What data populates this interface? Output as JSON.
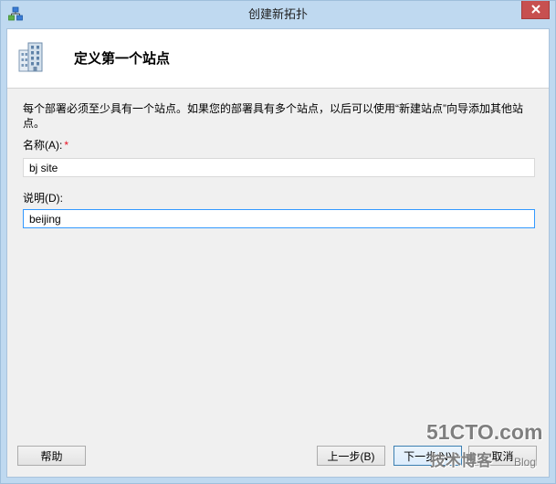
{
  "window": {
    "title": "创建新拓扑"
  },
  "header": {
    "title": "定义第一个站点"
  },
  "body": {
    "description": "每个部署必须至少具有一个站点。如果您的部署具有多个站点，以后可以使用“新建站点”向导添加其他站点。",
    "name_field": {
      "label": "名称(A):",
      "required_marker": "*",
      "value": "bj site"
    },
    "description_field": {
      "label": "说明(D):",
      "value": "beijing"
    }
  },
  "footer": {
    "help": "帮助",
    "back": "上一步(B)",
    "next": "下一步(N)",
    "cancel": "取消"
  },
  "watermark": {
    "brand": "51CTO.com",
    "subtitle": "技术博客",
    "blog": "Blog"
  },
  "icons": {
    "app": "topology-icon",
    "header": "building-icon",
    "close": "close-icon"
  },
  "colors": {
    "frame": "#bfd9f0",
    "close_button": "#c75050",
    "required_marker": "#e81123",
    "focus_border": "#3399ff",
    "default_button_border": "#3c7fb1"
  }
}
